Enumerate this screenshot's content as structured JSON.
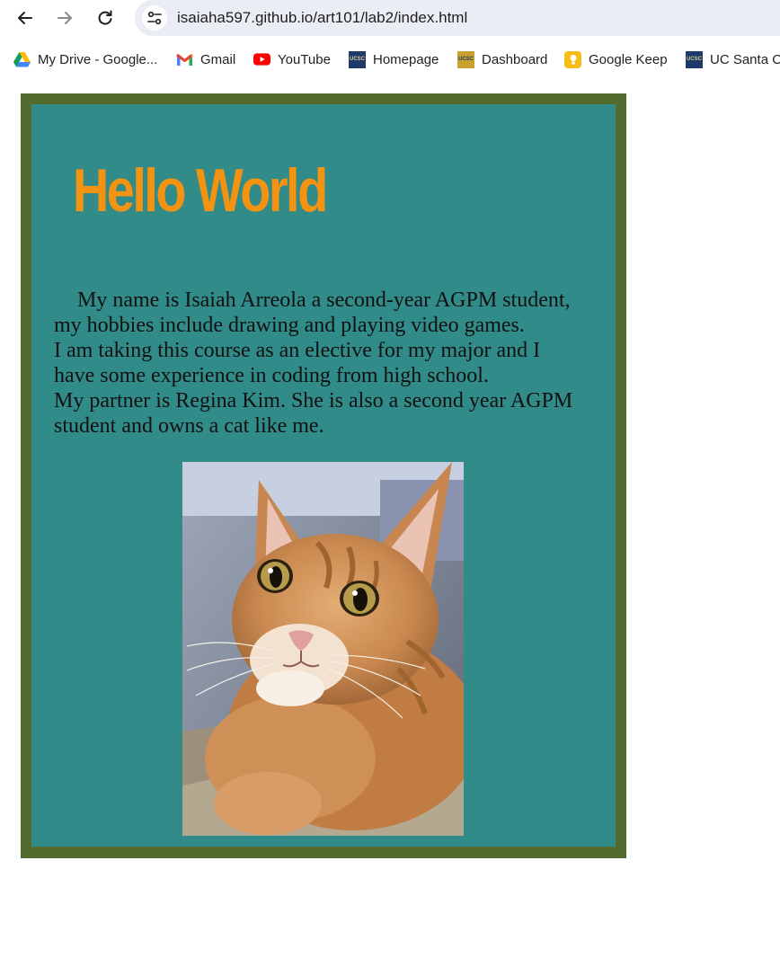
{
  "browser": {
    "url": "isaiaha597.github.io/art101/lab2/index.html",
    "bookmarks": [
      {
        "label": "My Drive - Google...",
        "icon": "google-drive-icon"
      },
      {
        "label": "Gmail",
        "icon": "gmail-icon"
      },
      {
        "label": "YouTube",
        "icon": "youtube-icon"
      },
      {
        "label": "Homepage",
        "icon": "ucsc-icon"
      },
      {
        "label": "Dashboard",
        "icon": "ucsc-canvas-icon"
      },
      {
        "label": "Google Keep",
        "icon": "google-keep-icon"
      },
      {
        "label": "UC Santa Cr",
        "icon": "ucsc-icon"
      }
    ],
    "ucsc_icon_text": "UCSC"
  },
  "page": {
    "title": "Hello World",
    "lines": [
      "My name is Isaiah Arreola a second-year AGPM student,",
      "my hobbies include drawing and playing video games.",
      "I am taking this course as an elective for my major and I",
      "have some experience in coding from high school.",
      "My partner is Regina Kim. She is also a second year AGPM",
      "student and owns a cat like me."
    ],
    "image": "orange-tabby-cat-photo"
  },
  "colors": {
    "frame_border": "#546b2e",
    "panel_bg": "#318b89",
    "title": "#f49211",
    "text": "#111111"
  }
}
